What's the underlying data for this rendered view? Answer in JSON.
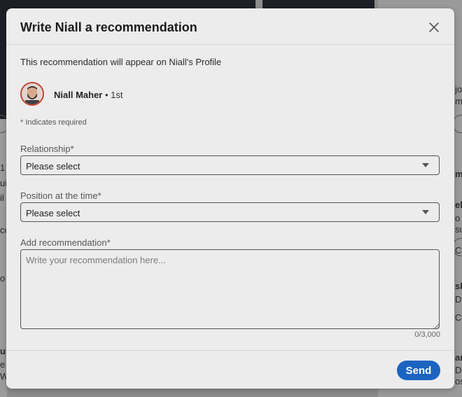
{
  "modal": {
    "title": "Write Niall a recommendation",
    "subtitle": "This recommendation will appear on Niall's Profile",
    "close_icon": "close-icon"
  },
  "recipient": {
    "name": "Niall Maher",
    "degree": " • 1st",
    "avatar_ring_color": "#c8402f"
  },
  "form": {
    "required_note": "* Indicates required",
    "relationship": {
      "label": "Relationship*",
      "value": "Please select"
    },
    "position": {
      "label": "Position at the time*",
      "value": "Please select"
    },
    "recommendation": {
      "label": "Add recommendation*",
      "placeholder": "Write your recommendation here...",
      "value": "",
      "char_count": "0/3,000"
    }
  },
  "footer": {
    "send_label": "Send",
    "send_color": "#1b64c2"
  },
  "background": {
    "fragments": [
      "1",
      "uil",
      "il",
      "co",
      "o",
      "up",
      "e",
      "W",
      "jo",
      "m",
      "m",
      "ek",
      "o",
      "su",
      "C",
      "sh",
      "D",
      "C",
      "ar",
      "D",
      "os"
    ]
  }
}
